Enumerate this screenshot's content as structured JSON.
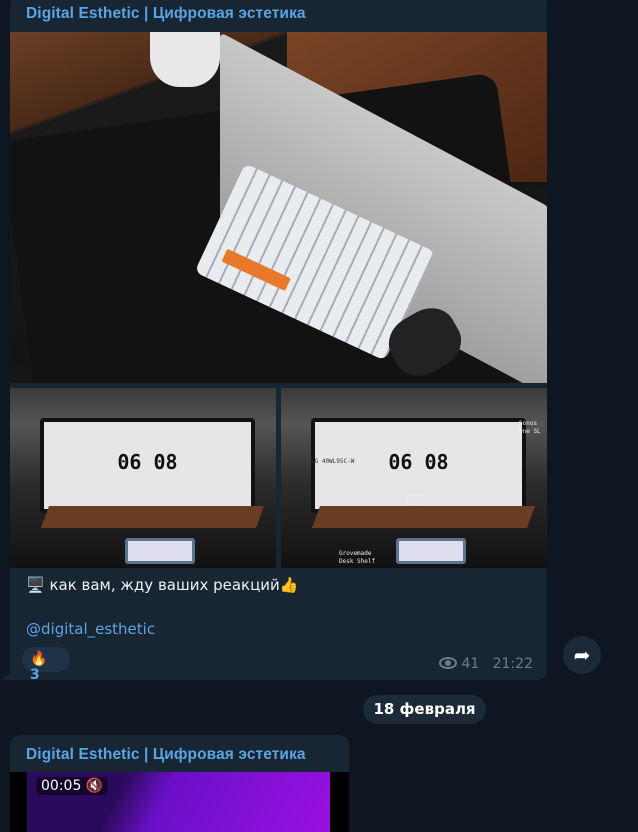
{
  "post": {
    "channel_title": "Digital Esthetic | Цифровая эстетика",
    "photo_labels": {
      "clock": "06 08",
      "monitor": "LG 40WL95C-W",
      "speaker": "Sonos\nOne SL",
      "soundbar": "Sonos\nBeam",
      "shelf": "Grovemade\nDesk Shelf"
    },
    "caption": "🖥️ как вам, жду ваших реакций👍",
    "link": "@digital_esthetic",
    "reaction": {
      "emoji": "🔥",
      "count": "3"
    },
    "views": "41",
    "time": "21:22"
  },
  "date_separator": "18 февраля",
  "next_post": {
    "channel_title": "Digital Esthetic | Цифровая эстетика",
    "video_time": "00:05",
    "muted_icon": "speaker-muted-icon"
  },
  "colors": {
    "background": "#0e1621",
    "bubble": "#182533",
    "accent": "#5aa4e6"
  }
}
